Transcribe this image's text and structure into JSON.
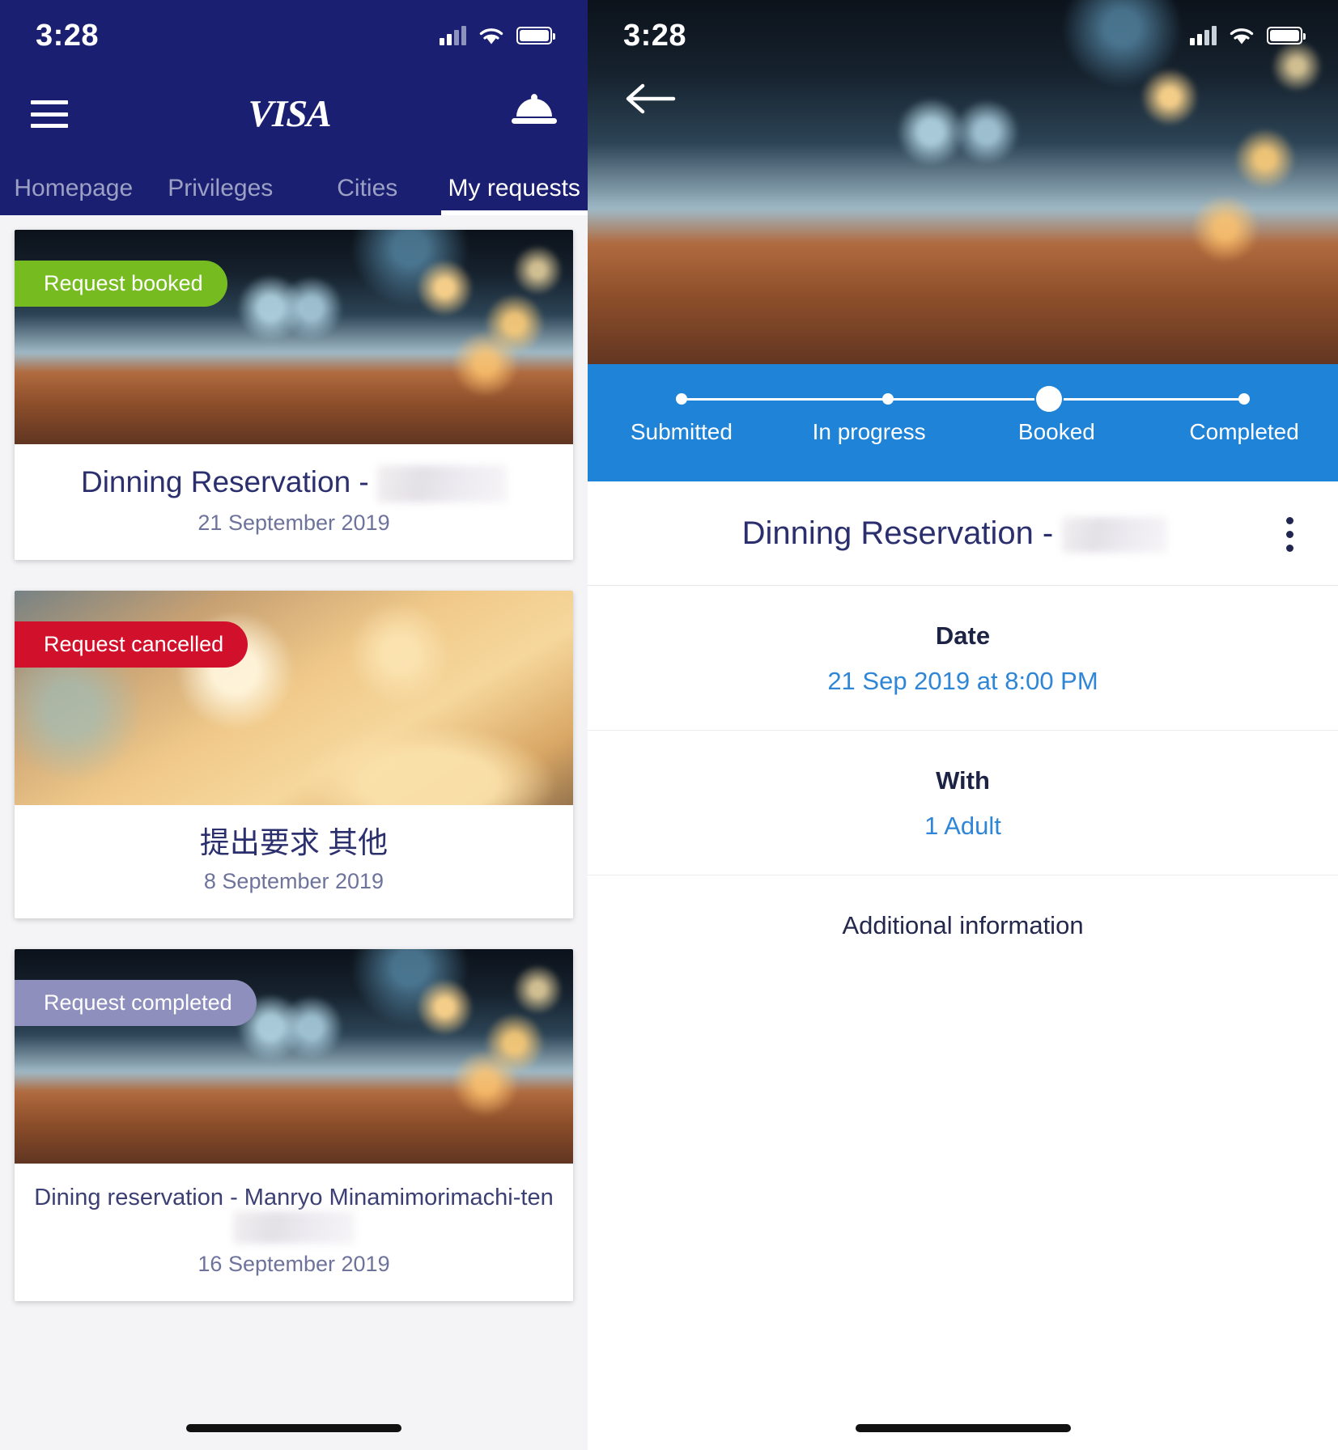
{
  "left": {
    "status": {
      "time": "3:28",
      "signal_icon": "cellular-bars-icon",
      "wifi_icon": "wifi-icon",
      "battery_icon": "battery-icon"
    },
    "header": {
      "menu_icon": "hamburger-menu-icon",
      "brand": "VISA",
      "concierge_icon": "service-bell-icon"
    },
    "tabs": [
      {
        "label": "Homepage",
        "active": false
      },
      {
        "label": "Privileges",
        "active": false
      },
      {
        "label": "Cities",
        "active": false
      },
      {
        "label": "My requests",
        "active": true
      }
    ],
    "cards": [
      {
        "badge": "Request booked",
        "badge_color": "#76bc21",
        "title": "Dinning Reservation - ",
        "title_redacted": true,
        "date": "21 September 2019",
        "photo": "dining-table-photo"
      },
      {
        "badge": "Request cancelled",
        "badge_color": "#d1112b",
        "title": "提出要求 其他",
        "title_redacted": false,
        "date": "8 September 2019",
        "photo": "service-bell-photo"
      },
      {
        "badge": "Request completed",
        "badge_color": "#8e8fbd",
        "title": "Dining reservation - Manryo Minamimorimachi-ten",
        "title_redacted": true,
        "date": "16 September 2019",
        "photo": "dining-table-photo"
      }
    ]
  },
  "right": {
    "status": {
      "time": "3:28",
      "signal_icon": "cellular-bars-icon",
      "wifi_icon": "wifi-icon",
      "battery_icon": "battery-icon"
    },
    "back_icon": "arrow-left-icon",
    "hero_photo": "dining-table-photo",
    "stepper": {
      "accent": "#1f83d8",
      "steps": [
        {
          "label": "Submitted",
          "state": "done"
        },
        {
          "label": "In progress",
          "state": "done"
        },
        {
          "label": "Booked",
          "state": "current"
        },
        {
          "label": "Completed",
          "state": "upcoming"
        }
      ]
    },
    "detail_title": "Dinning Reservation - ",
    "detail_title_redacted": true,
    "menu_icon": "kebab-menu-icon",
    "fields": [
      {
        "label": "Date",
        "value": "21 Sep 2019 at 8:00 PM",
        "value_color": "#2f86d6"
      },
      {
        "label": "With",
        "value": "1 Adult",
        "value_color": "#2f86d6"
      },
      {
        "label": "Additional information",
        "value": "",
        "value_color": ""
      }
    ]
  }
}
